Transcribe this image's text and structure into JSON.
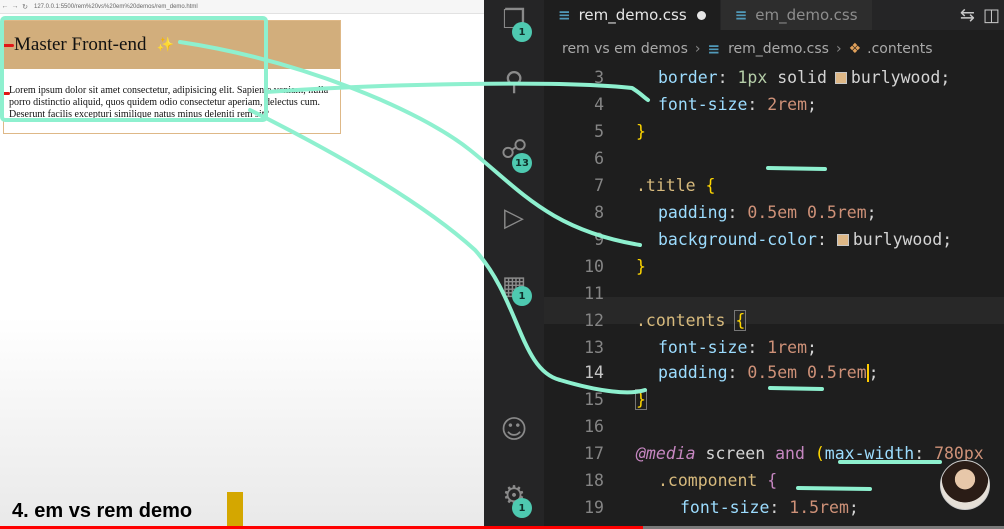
{
  "browser": {
    "url": "127.0.0.1:5500/rem%20vs%20em%20demos/rem_demo.html",
    "nav_icons": [
      "back-arrow-icon",
      "forward-arrow-icon",
      "reload-icon"
    ],
    "title_text": "Master Front-end",
    "title_emoji": "✨",
    "contents_text": "Lorem ipsum dolor sit amet consectetur, adipisicing elit. Sapiente veniam, nulla porro distinctio aliquid, quos quidem odio consectetur aperiam, delectus cum. Deserunt facilis excepturi similique natus minus deleniti rem sit?"
  },
  "vscode": {
    "tabs": [
      {
        "label": "rem_demo.css",
        "active": true,
        "modified": true
      },
      {
        "label": "em_demo.css",
        "active": false,
        "modified": false
      }
    ],
    "breadcrumb": {
      "folder": "rem vs em demos",
      "file": "rem_demo.css",
      "symbol": ".contents"
    },
    "badges": {
      "explorer": "1",
      "source_control": "13",
      "extensions": "1",
      "settings": "1"
    },
    "code": {
      "l3": {
        "n": "3",
        "prop": "border",
        "p1": ": ",
        "num": "1px",
        "p2": " ",
        "val": "solid",
        "val2": "burlywood",
        "p3": ";"
      },
      "l4": {
        "n": "4",
        "prop": "font-size",
        "p1": ": ",
        "num": "2rem",
        "p2": ";"
      },
      "l5": {
        "n": "5",
        "brace": "}"
      },
      "l6": {
        "n": "6"
      },
      "l7": {
        "n": "7",
        "sel": ".title",
        "p1": " ",
        "brace": "{"
      },
      "l8": {
        "n": "8",
        "prop": "padding",
        "p1": ": ",
        "num1": "0.5em",
        "p2": " ",
        "num2": "0.5rem",
        "p3": ";"
      },
      "l9": {
        "n": "9",
        "prop": "background-color",
        "p1": ": ",
        "val": "burlywood",
        "p2": ";"
      },
      "l10": {
        "n": "10",
        "brace": "}"
      },
      "l11": {
        "n": "11"
      },
      "l12": {
        "n": "12",
        "sel": ".contents",
        "p1": " ",
        "brace": "{"
      },
      "l13": {
        "n": "13",
        "prop": "font-size",
        "p1": ": ",
        "num": "1rem",
        "p2": ";"
      },
      "l14": {
        "n": "14",
        "prop": "padding",
        "p1": ": ",
        "num1": "0.5em",
        "p2": " ",
        "num2": "0.5rem",
        "p3": ";"
      },
      "l15": {
        "n": "15",
        "brace": "}"
      },
      "l16": {
        "n": "16"
      },
      "l17": {
        "n": "17",
        "kw": "@media",
        "t1": " screen ",
        "t2": "and",
        "t3": " (",
        "prop": "max-width",
        "p1": ": ",
        "num": "780px"
      },
      "l18": {
        "n": "18",
        "sel": ".component",
        "p1": " ",
        "brace": "{"
      },
      "l19": {
        "n": "19",
        "prop": "font-size",
        "p1": ": ",
        "num": "1.5rem",
        "p2": ";"
      }
    }
  },
  "overlay": {
    "caption": "4. em vs rem demo",
    "progress": 0.64,
    "colors": {
      "annotation": "#8ef0cf",
      "progress": "#ff0000",
      "marker": "#d4a700"
    }
  }
}
